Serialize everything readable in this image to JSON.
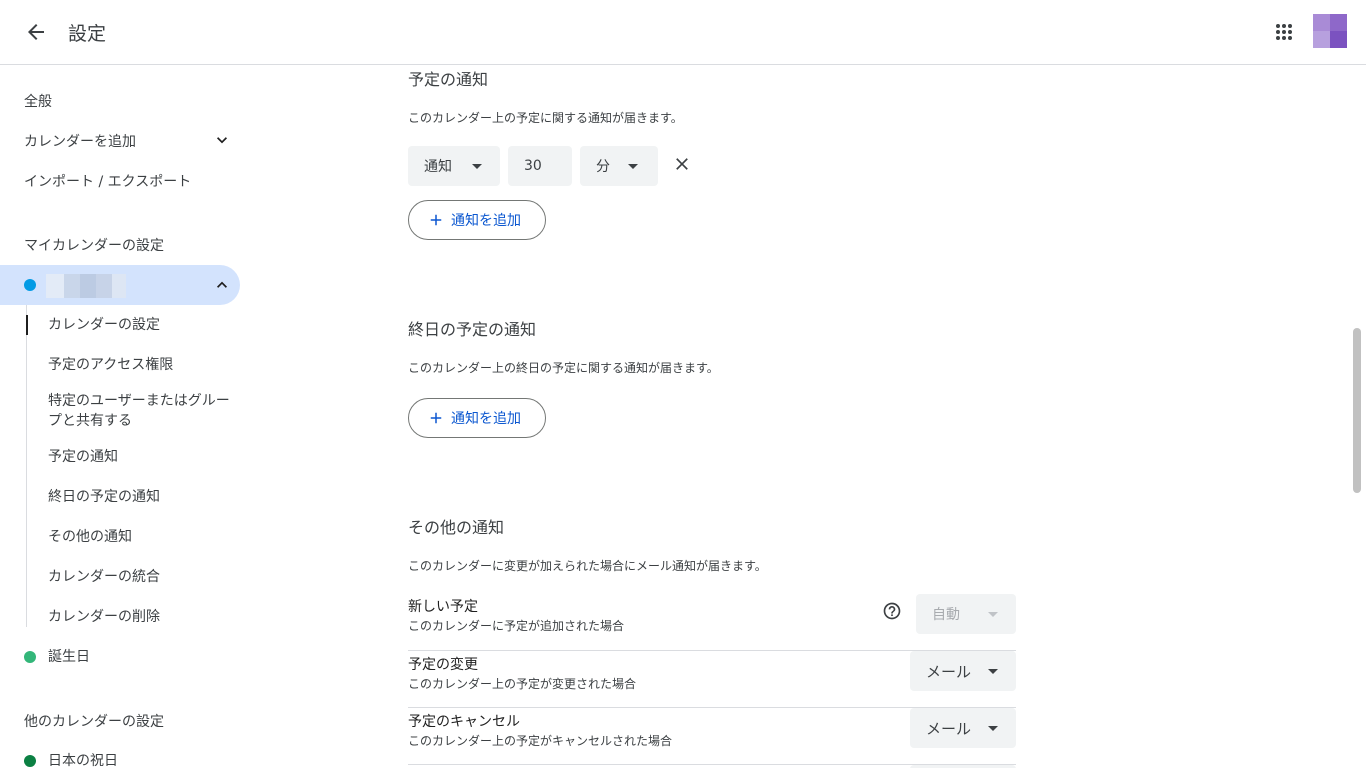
{
  "header": {
    "title": "設定"
  },
  "sidebar": {
    "general": "全般",
    "add_calendar": "カレンダーを追加",
    "import_export": "インポート / エクスポート",
    "my_calendars_heading": "マイカレンダーの設定",
    "sub_items": [
      "カレンダーの設定",
      "予定のアクセス権限",
      "特定のユーザーまたはグループと共有する",
      "予定の通知",
      "終日の予定の通知",
      "その他の通知",
      "カレンダーの統合",
      "カレンダーの削除"
    ],
    "birthdays": "誕生日",
    "other_calendars_heading": "他のカレンダーの設定",
    "japan_holidays": "日本の祝日"
  },
  "event_notifications": {
    "title": "予定の通知",
    "description": "このカレンダー上の予定に関する通知が届きます。",
    "type": "通知",
    "amount": "30",
    "unit": "分",
    "add_label": "通知を追加"
  },
  "allday_notifications": {
    "title": "終日の予定の通知",
    "description": "このカレンダー上の終日の予定に関する通知が届きます。",
    "add_label": "通知を追加"
  },
  "other_notifications": {
    "title": "その他の通知",
    "description": "このカレンダーに変更が加えられた場合にメール通知が届きます。",
    "rows": [
      {
        "name": "新しい予定",
        "sub": "このカレンダーに予定が追加された場合",
        "value": "自動"
      },
      {
        "name": "予定の変更",
        "sub": "このカレンダー上の予定が変更された場合",
        "value": "メール"
      },
      {
        "name": "予定のキャンセル",
        "sub": "このカレンダー上の予定がキャンセルされた場合",
        "value": "メール"
      }
    ]
  },
  "colors": {
    "selected_calendar": "#d3e3fd",
    "my_calendar_dot": "#039be5",
    "birthday_dot": "#33b679",
    "holiday_dot": "#0b8043",
    "accent": "#0b57d0"
  },
  "icons": {
    "back": "arrow-left-icon",
    "apps": "apps-grid-icon",
    "expand": "chevron-down-icon",
    "collapse": "chevron-up-icon",
    "remove": "close-icon",
    "add": "plus-icon",
    "help": "help-circle-icon"
  }
}
